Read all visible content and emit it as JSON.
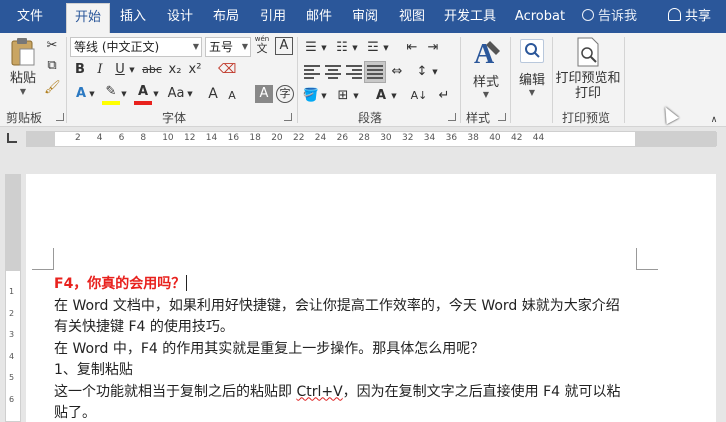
{
  "tabs": [
    "文件",
    "开始",
    "插入",
    "设计",
    "布局",
    "引用",
    "邮件",
    "审阅",
    "视图",
    "开发工具",
    "Acrobat"
  ],
  "active_tab": "开始",
  "tell_me": "告诉我",
  "share": "共享",
  "clipboard": {
    "paste": "粘贴",
    "group": "剪贴板"
  },
  "font": {
    "name": "等线 (中文正文)",
    "size": "五号",
    "wen": "wén",
    "wen_char": "文",
    "a_box": "A",
    "bold": "B",
    "italic": "I",
    "underline": "U",
    "strike": "abc",
    "subscript": "x₂",
    "superscript": "x²",
    "aa": "Aa",
    "grow": "A",
    "shrink": "A",
    "group": "字体"
  },
  "paragraph": {
    "group": "段落"
  },
  "styles": {
    "label": "样式",
    "group": "样式"
  },
  "editing": {
    "label": "编辑"
  },
  "print_preview": {
    "label_line1": "打印预览和",
    "label_line2": "打印",
    "group": "打印预览"
  },
  "ruler_numbers": [
    "2",
    "4",
    "6",
    "8",
    "10",
    "12",
    "14",
    "16",
    "18",
    "20",
    "22",
    "24",
    "26",
    "28",
    "30",
    "32",
    "34",
    "36",
    "38",
    "40",
    "42",
    "44"
  ],
  "vruler_numbers": [
    "1",
    "2",
    "3",
    "4",
    "5",
    "6"
  ],
  "document": {
    "title": "F4，你真的会用吗？",
    "lines": [
      "在 Word 文档中，如果利用好快捷键，会让你提高工作效率的，今天 Word 妹就为大家介绍",
      "有关快捷键 F4 的使用技巧。",
      "在 Word 中，F4 的作用其实就是重复上一步操作。那具体怎么用呢？",
      "1、复制粘贴"
    ],
    "line_ctrl_before": "这一个功能就相当于复制之后的粘贴即 ",
    "line_ctrl_key": "Ctrl+V",
    "line_ctrl_after": "，因为在复制文字之后直接使用 F4 就可以粘",
    "last_line": "贴了。"
  },
  "colors": {
    "accent": "#2b579a",
    "title_red": "#e8211d",
    "highlight": "#ffff00",
    "font_red": "#e8211d"
  }
}
